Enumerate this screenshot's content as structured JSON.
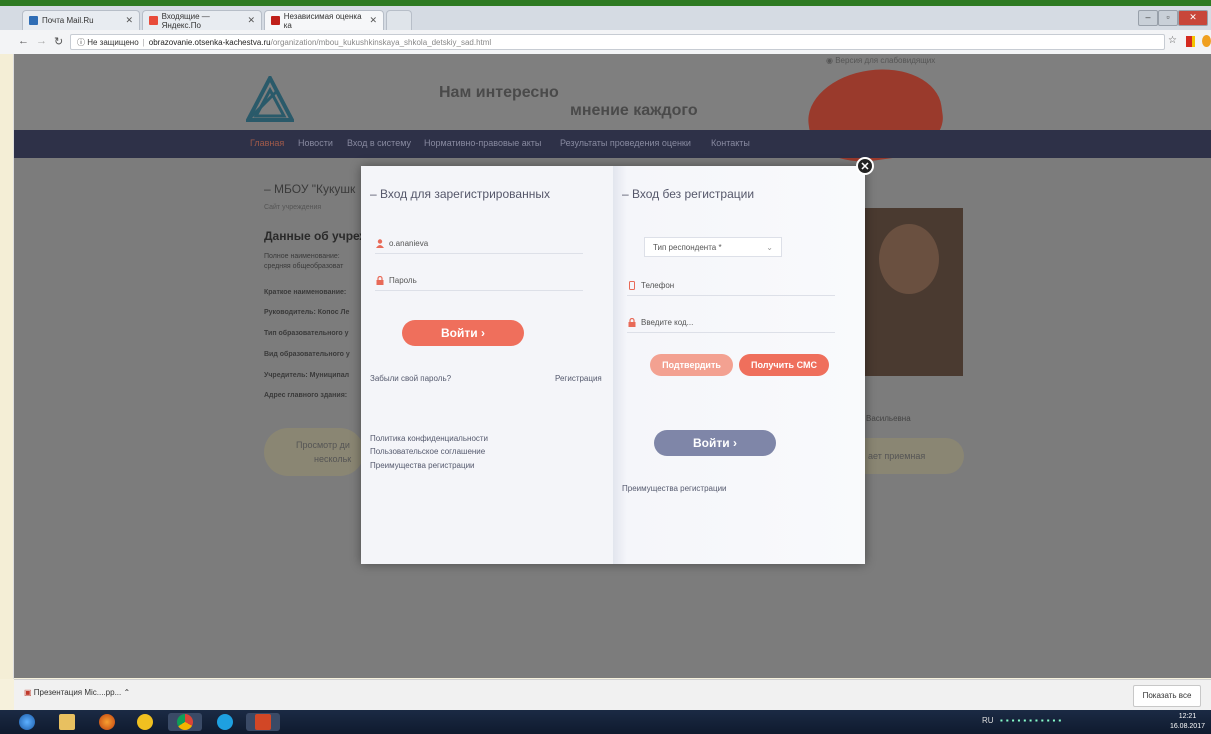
{
  "browser": {
    "tabs": [
      {
        "label": "Почта Mail.Ru",
        "color": "#2f6db5"
      },
      {
        "label": "Входящие — Яндекс.По",
        "color": "#e84b3a"
      },
      {
        "label": "Независимая оценка ка",
        "color": "#c0201a"
      }
    ],
    "url_security": "Не защищено",
    "url_host": "obrazovanie.otsenka-kachestva.ru",
    "url_path": "/organization/mbou_kukushkinskaya_shkola_detskiy_sad.html"
  },
  "site": {
    "blind_version": "Версия для слабовидящих",
    "tagline_1": "Нам интересно",
    "tagline_2": "мнение каждого",
    "nav": [
      "Главная",
      "Новости",
      "Вход в систему",
      "Нормативно-правовые акты",
      "Результаты проведения оценки",
      "Контакты"
    ],
    "page_title": "– МБОУ \"Кукушк",
    "page_sub": "Сайт учреждения",
    "section_title": "Данные об учреж",
    "info_lines": [
      "Полное наименование:",
      "средняя общеобразоват",
      "Краткое наименование:",
      "Руководитель: Копос Ле",
      "Тип образовательного у",
      "Вид образовательного у",
      "Учредитель: Муниципал",
      "Адрес главного здания:"
    ],
    "left_pill_1": "Просмотр ди",
    "left_pill_2": "нескольк",
    "right_pill": "ает приемная",
    "director_name": "Васильевна"
  },
  "login_registered": {
    "title": "– Вход для зарегистрированных",
    "username_value": "o.ananieva",
    "password_placeholder": "Пароль",
    "login_label": "Войти",
    "forgot_label": "Забыли свой пароль?",
    "register_label": "Регистрация",
    "links": [
      "Политика конфиденциальности",
      "Пользовательское соглашение",
      "Преимущества регистрации"
    ]
  },
  "login_anonymous": {
    "title": "– Вход без регистрации",
    "respondent_placeholder": "Тип респондента *",
    "phone_placeholder": "Телефон",
    "code_placeholder": "Введите код...",
    "confirm_label": "Подтвердить",
    "get_sms_label": "Получить СМС",
    "login_label": "Войти",
    "benefits_label": "Преимущества регистрации"
  },
  "downloads": {
    "item_label": "Презентация Mic....pp...",
    "show_all_label": "Показать все"
  },
  "taskbar": {
    "lang": "RU",
    "time": "12:21",
    "date": "16.08.2017"
  }
}
